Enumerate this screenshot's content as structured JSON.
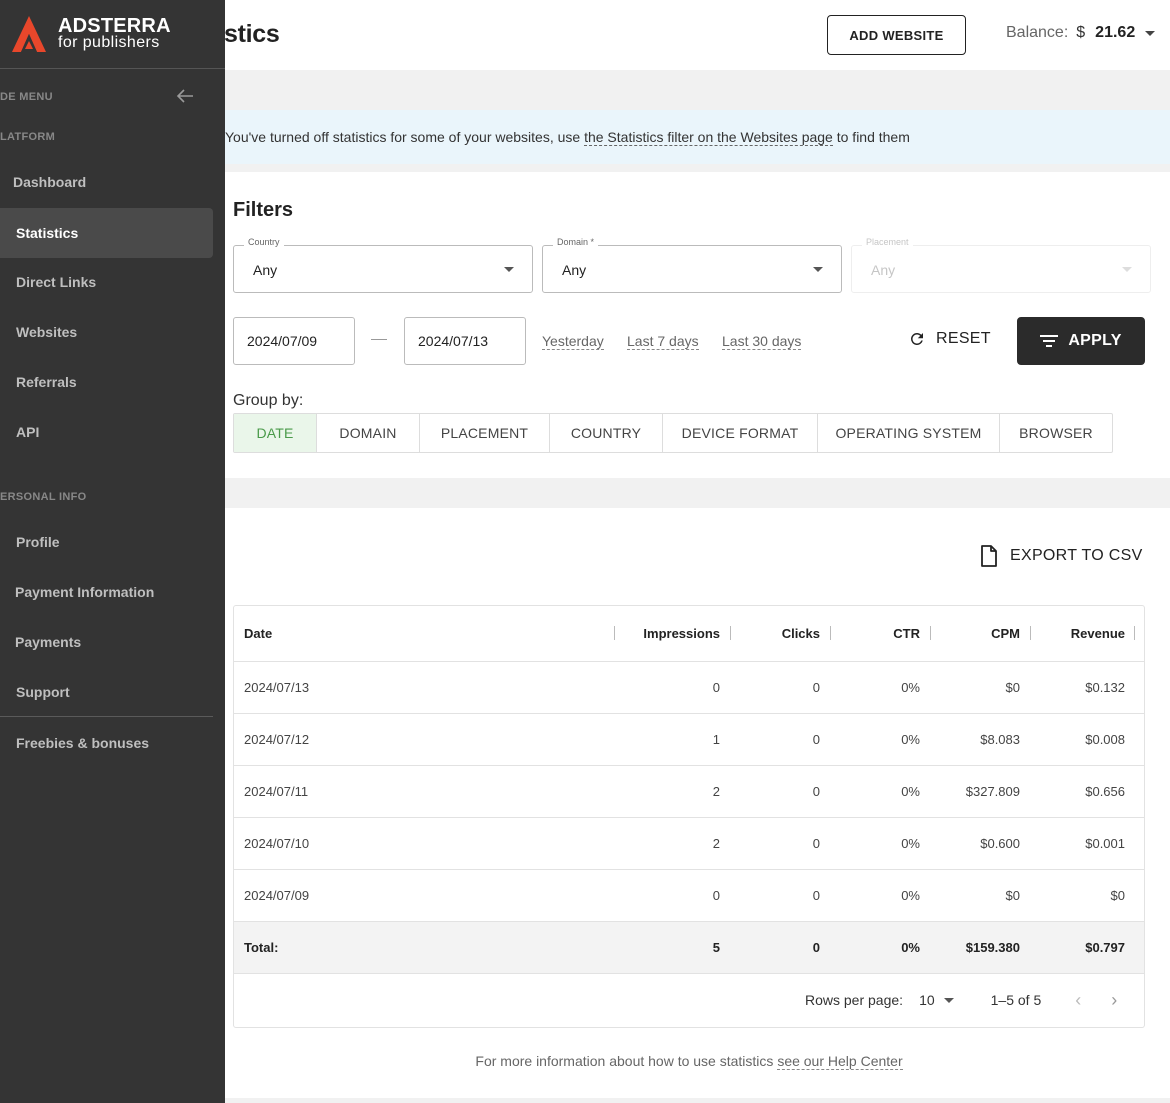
{
  "header": {
    "title": "stics",
    "add_website": "ADD WEBSITE",
    "balance_label": "Balance:",
    "balance_currency": "$",
    "balance_amount": "21.62"
  },
  "sidebar": {
    "brand": "ADSTERRA",
    "brand_sub": "for publishers",
    "side_menu_label": "DE MENU",
    "platform_label": "LATFORM",
    "personal_label": "ERSONAL INFO",
    "items": [
      {
        "label": "Dashboard"
      },
      {
        "label": "Statistics"
      },
      {
        "label": "Direct Links"
      },
      {
        "label": "Websites"
      },
      {
        "label": "Referrals"
      },
      {
        "label": "API"
      },
      {
        "label": "Profile"
      },
      {
        "label": "Payment Information"
      },
      {
        "label": "Payments"
      },
      {
        "label": "Support"
      },
      {
        "label": "Freebies & bonuses"
      }
    ]
  },
  "notice": {
    "text_before": "You've turned off statistics for some of your websites, use ",
    "link": "the Statistics filter on the Websites page",
    "text_after": " to find them"
  },
  "filters": {
    "title": "Filters",
    "country_label": "Country",
    "country_value": "Any",
    "domain_label": "Domain *",
    "domain_value": "Any",
    "placement_label": "Placement",
    "placement_value": "Any",
    "date_from": "2024/07/09",
    "date_to": "2024/07/13",
    "quick": [
      "Yesterday",
      "Last 7 days",
      "Last 30 days"
    ],
    "reset": "RESET",
    "apply": "APPLY",
    "group_label": "Group by:",
    "group_options": [
      "DATE",
      "DOMAIN",
      "PLACEMENT",
      "COUNTRY",
      "DEVICE FORMAT",
      "OPERATING SYSTEM",
      "BROWSER"
    ],
    "group_selected": "DATE"
  },
  "table": {
    "export": "EXPORT TO CSV",
    "columns": [
      "Date",
      "Impressions",
      "Clicks",
      "CTR",
      "CPM",
      "Revenue"
    ],
    "rows": [
      [
        "2024/07/13",
        "0",
        "0",
        "0%",
        "$0",
        "$0.132"
      ],
      [
        "2024/07/12",
        "1",
        "0",
        "0%",
        "$8.083",
        "$0.008"
      ],
      [
        "2024/07/11",
        "2",
        "0",
        "0%",
        "$327.809",
        "$0.656"
      ],
      [
        "2024/07/10",
        "2",
        "0",
        "0%",
        "$0.600",
        "$0.001"
      ],
      [
        "2024/07/09",
        "0",
        "0",
        "0%",
        "$0",
        "$0"
      ]
    ],
    "total": [
      "Total:",
      "5",
      "0",
      "0%",
      "$159.380",
      "$0.797"
    ],
    "rows_per_page_label": "Rows per page:",
    "rows_per_page": "10",
    "range": "1–5 of 5"
  },
  "help": {
    "text_before": "For more information about how to use statistics ",
    "link": "see our Help Center"
  },
  "colors": {
    "sidebar_bg": "#343434",
    "accent": "#4a9a4a",
    "logo": "#e8472b",
    "apply_bg": "#2b2b2b",
    "notice_bg": "#eaf5fb"
  }
}
